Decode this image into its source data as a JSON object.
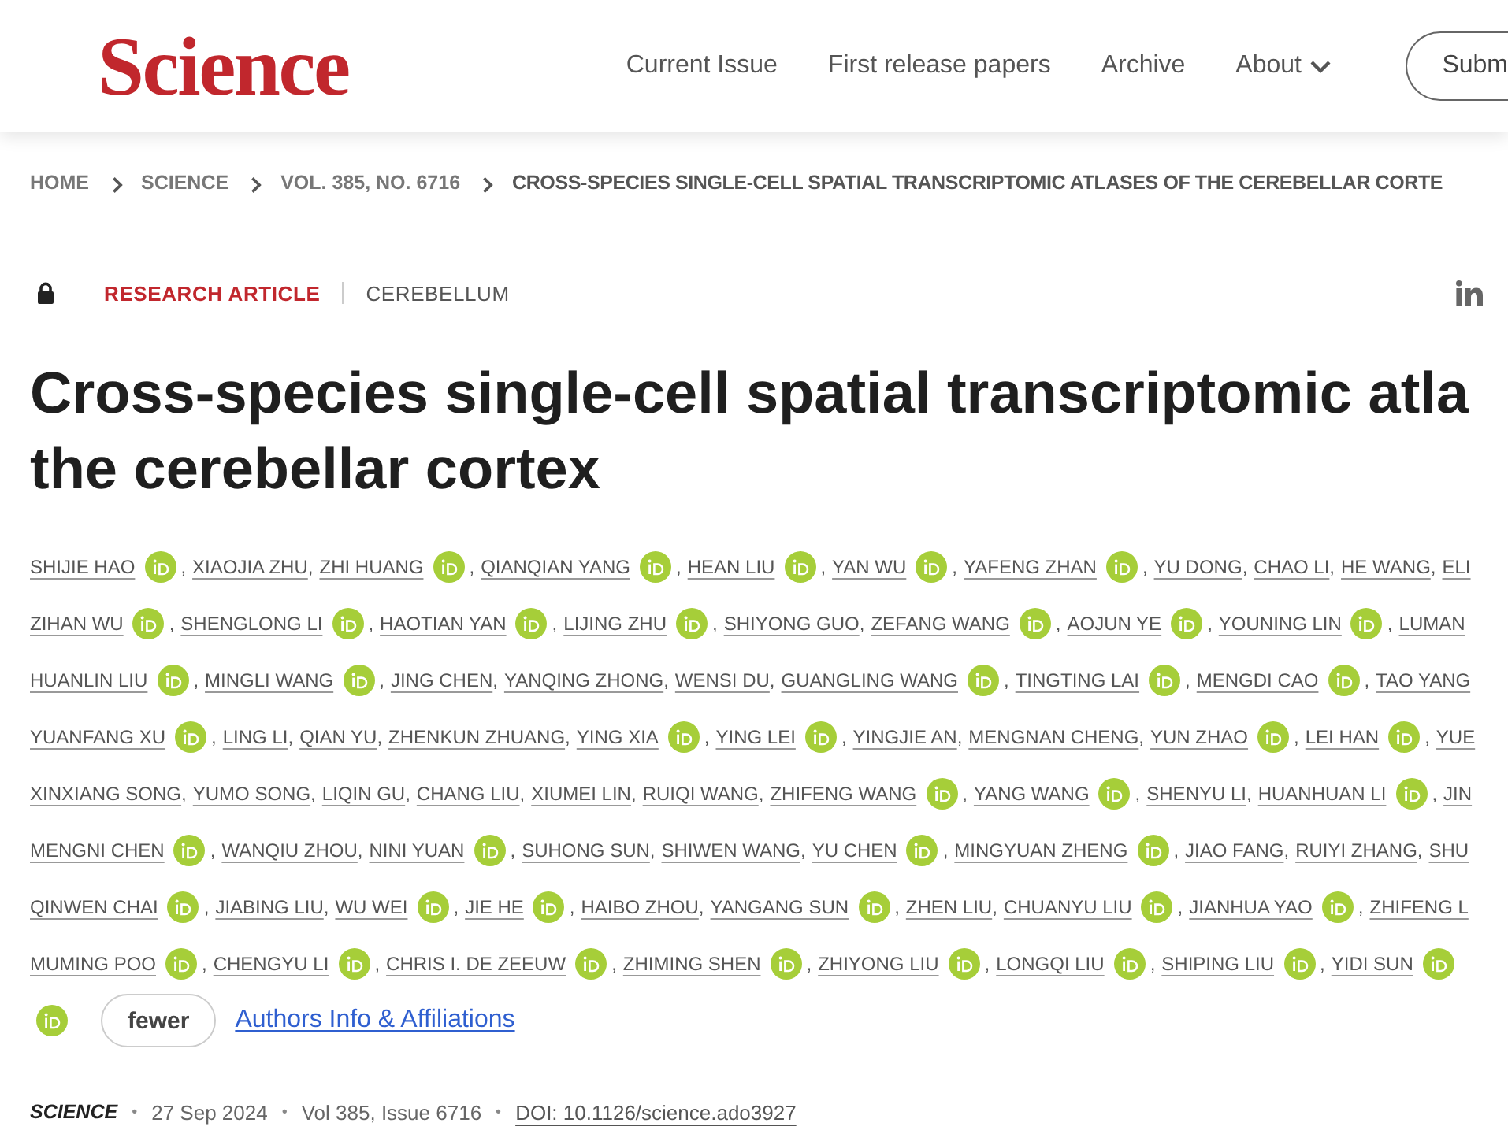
{
  "header": {
    "logo": "Science",
    "nav": [
      {
        "label": "Current Issue",
        "kind": "link"
      },
      {
        "label": "First release papers",
        "kind": "link"
      },
      {
        "label": "Archive",
        "kind": "link"
      },
      {
        "label": "About",
        "kind": "menu"
      }
    ],
    "submit_button": "Subm"
  },
  "breadcrumb": [
    {
      "label": "HOME",
      "current": false
    },
    {
      "label": "SCIENCE",
      "current": false
    },
    {
      "label": "VOL. 385, NO. 6716",
      "current": false
    },
    {
      "label": "CROSS-SPECIES SINGLE-CELL SPATIAL TRANSCRIPTOMIC ATLASES OF THE CEREBELLAR CORTE",
      "current": true
    }
  ],
  "article": {
    "type_label": "RESEARCH ARTICLE",
    "section": "CEREBELLUM",
    "title_lines": [
      "Cross-species single-cell spatial transcriptomic atla",
      "the cerebellar cortex"
    ],
    "author_lines": [
      [
        {
          "name": "SHIJIE HAO",
          "orcid": true,
          "sep": ","
        },
        {
          "name": "XIAOJIA ZHU",
          "orcid": false,
          "sep": ","
        },
        {
          "name": "ZHI HUANG",
          "orcid": true,
          "sep": ","
        },
        {
          "name": "QIANQIAN YANG",
          "orcid": true,
          "sep": ","
        },
        {
          "name": "HEAN LIU",
          "orcid": true,
          "sep": ","
        },
        {
          "name": "YAN WU",
          "orcid": true,
          "sep": ","
        },
        {
          "name": "YAFENG ZHAN",
          "orcid": true,
          "sep": ","
        },
        {
          "name": "YU DONG",
          "orcid": false,
          "sep": ","
        },
        {
          "name": "CHAO LI",
          "orcid": false,
          "sep": ","
        },
        {
          "name": "HE WANG",
          "orcid": false,
          "sep": ","
        },
        {
          "name": "ELI",
          "orcid": false
        }
      ],
      [
        {
          "name": "ZIHAN WU",
          "orcid": true,
          "sep": ","
        },
        {
          "name": "SHENGLONG LI",
          "orcid": true,
          "sep": ","
        },
        {
          "name": "HAOTIAN YAN",
          "orcid": true,
          "sep": ","
        },
        {
          "name": "LIJING ZHU",
          "orcid": true,
          "sep": ","
        },
        {
          "name": "SHIYONG GUO",
          "orcid": false,
          "sep": ","
        },
        {
          "name": "ZEFANG WANG",
          "orcid": true,
          "sep": ","
        },
        {
          "name": "AOJUN YE",
          "orcid": true,
          "sep": ","
        },
        {
          "name": "YOUNING LIN",
          "orcid": true,
          "sep": ","
        },
        {
          "name": "LUMAN",
          "orcid": false
        }
      ],
      [
        {
          "name": "HUANLIN LIU",
          "orcid": true,
          "sep": ","
        },
        {
          "name": "MINGLI WANG",
          "orcid": true,
          "sep": ","
        },
        {
          "name": "JING CHEN",
          "orcid": false,
          "sep": ","
        },
        {
          "name": "YANQING ZHONG",
          "orcid": false,
          "sep": ","
        },
        {
          "name": "WENSI DU",
          "orcid": false,
          "sep": ","
        },
        {
          "name": "GUANGLING WANG",
          "orcid": true,
          "sep": ","
        },
        {
          "name": "TINGTING LAI",
          "orcid": true,
          "sep": ","
        },
        {
          "name": "MENGDI CAO",
          "orcid": true,
          "sep": ","
        },
        {
          "name": "TAO YANG",
          "orcid": false
        }
      ],
      [
        {
          "name": "YUANFANG XU",
          "orcid": true,
          "sep": ","
        },
        {
          "name": "LING LI",
          "orcid": false,
          "sep": ","
        },
        {
          "name": "QIAN YU",
          "orcid": false,
          "sep": ","
        },
        {
          "name": "ZHENKUN ZHUANG",
          "orcid": false,
          "sep": ","
        },
        {
          "name": "YING XIA",
          "orcid": true,
          "sep": ","
        },
        {
          "name": "YING LEI",
          "orcid": true,
          "sep": ","
        },
        {
          "name": "YINGJIE AN",
          "orcid": false,
          "sep": ","
        },
        {
          "name": "MENGNAN CHENG",
          "orcid": false,
          "sep": ","
        },
        {
          "name": "YUN ZHAO",
          "orcid": true,
          "sep": ","
        },
        {
          "name": "LEI HAN",
          "orcid": true,
          "sep": ","
        },
        {
          "name": "YUE",
          "orcid": false
        }
      ],
      [
        {
          "name": "XINXIANG SONG",
          "orcid": false,
          "sep": ","
        },
        {
          "name": "YUMO SONG",
          "orcid": false,
          "sep": ","
        },
        {
          "name": "LIQIN GU",
          "orcid": false,
          "sep": ","
        },
        {
          "name": "CHANG LIU",
          "orcid": false,
          "sep": ","
        },
        {
          "name": "XIUMEI LIN",
          "orcid": false,
          "sep": ","
        },
        {
          "name": "RUIQI WANG",
          "orcid": false,
          "sep": ","
        },
        {
          "name": "ZHIFENG WANG",
          "orcid": true,
          "sep": ","
        },
        {
          "name": "YANG WANG",
          "orcid": true,
          "sep": ","
        },
        {
          "name": "SHENYU LI",
          "orcid": false,
          "sep": ","
        },
        {
          "name": "HUANHUAN LI",
          "orcid": true,
          "sep": ","
        },
        {
          "name": "JIN",
          "orcid": false
        }
      ],
      [
        {
          "name": "MENGNI CHEN",
          "orcid": true,
          "sep": ","
        },
        {
          "name": "WANQIU ZHOU",
          "orcid": false,
          "sep": ","
        },
        {
          "name": "NINI YUAN",
          "orcid": true,
          "sep": ","
        },
        {
          "name": "SUHONG SUN",
          "orcid": false,
          "sep": ","
        },
        {
          "name": "SHIWEN WANG",
          "orcid": false,
          "sep": ","
        },
        {
          "name": "YU CHEN",
          "orcid": true,
          "sep": ","
        },
        {
          "name": "MINGYUAN ZHENG",
          "orcid": true,
          "sep": ","
        },
        {
          "name": "JIAO FANG",
          "orcid": false,
          "sep": ","
        },
        {
          "name": "RUIYI ZHANG",
          "orcid": false,
          "sep": ","
        },
        {
          "name": "SHU",
          "orcid": false
        }
      ],
      [
        {
          "name": "QINWEN CHAI",
          "orcid": true,
          "sep": ","
        },
        {
          "name": "JIABING LIU",
          "orcid": false,
          "sep": ","
        },
        {
          "name": "WU WEI",
          "orcid": true,
          "sep": ","
        },
        {
          "name": "JIE HE",
          "orcid": true,
          "sep": ","
        },
        {
          "name": "HAIBO ZHOU",
          "orcid": false,
          "sep": ","
        },
        {
          "name": "YANGANG SUN",
          "orcid": true,
          "sep": ","
        },
        {
          "name": "ZHEN LIU",
          "orcid": false,
          "sep": ","
        },
        {
          "name": "CHUANYU LIU",
          "orcid": true,
          "sep": ","
        },
        {
          "name": "JIANHUA YAO",
          "orcid": true,
          "sep": ","
        },
        {
          "name": "ZHIFENG L",
          "orcid": false
        }
      ],
      [
        {
          "name": "MUMING POO",
          "orcid": true,
          "sep": ","
        },
        {
          "name": "CHENGYU LI",
          "orcid": true,
          "sep": ","
        },
        {
          "name": "CHRIS I. DE ZEEUW",
          "orcid": true,
          "sep": ","
        },
        {
          "name": "ZHIMING SHEN",
          "orcid": true,
          "sep": ","
        },
        {
          "name": "ZHIYONG LIU",
          "orcid": true,
          "sep": ","
        },
        {
          "name": "LONGQI LIU",
          "orcid": true,
          "sep": ","
        },
        {
          "name": "SHIPING LIU",
          "orcid": true,
          "sep": ","
        },
        {
          "name": "YIDI SUN",
          "orcid": true
        }
      ],
      [
        {
          "orcid": true
        }
      ]
    ],
    "fewer_button": "fewer",
    "affiliations_link": "Authors Info & Affiliations",
    "meta": [
      {
        "kind": "journal",
        "text": "SCIENCE"
      },
      {
        "kind": "separator",
        "text": "•"
      },
      {
        "kind": "date",
        "text": "27 Sep 2024"
      },
      {
        "kind": "separator",
        "text": "•"
      },
      {
        "kind": "issue",
        "text": "Vol 385, Issue 6716"
      },
      {
        "kind": "separator",
        "text": "•"
      },
      {
        "kind": "doi",
        "text": "DOI: 10.1126/science.ado3927"
      }
    ]
  }
}
